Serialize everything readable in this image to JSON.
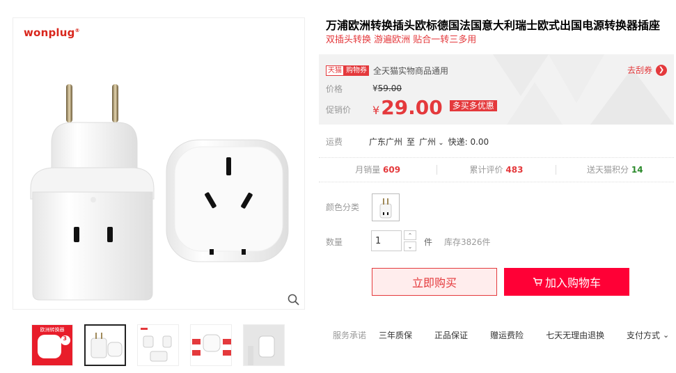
{
  "gallery": {
    "brand": "wonplug",
    "brand_mark": "®",
    "thumbnails": [
      {
        "name": "thumb-1"
      },
      {
        "name": "thumb-2"
      },
      {
        "name": "thumb-3"
      },
      {
        "name": "thumb-4"
      },
      {
        "name": "thumb-5"
      }
    ],
    "thumb1_text": "欧洲转换器",
    "thumb1_num": "3"
  },
  "product": {
    "title": "万浦欧洲转换插头欧标德国法国意大利瑞士欧式出国电源转换器插座",
    "subtitle": "双插头转换 游遍欧洲 贴合一转三多用"
  },
  "pricing": {
    "tag_tmall": "天猫",
    "tag_coupon": "购物券",
    "coupon_desc": "全天猫实物商品通用",
    "get_coupon": "去刮券",
    "price_label": "价格",
    "orig_currency": "¥",
    "orig_price": "59.00",
    "promo_label": "促销价",
    "promo_currency": "¥",
    "promo_price": "29.00",
    "promo_badge": "多买多优惠"
  },
  "shipping": {
    "label": "运费",
    "from": "广东广州",
    "to_word": "至",
    "to": "广州",
    "express": "快递: 0.00"
  },
  "stats": {
    "monthly_sales_label": "月销量",
    "monthly_sales": "609",
    "reviews_label": "累计评价",
    "reviews": "483",
    "points_label": "送天猫积分",
    "points": "14"
  },
  "options": {
    "color_label": "颜色分类",
    "qty_label": "数量",
    "qty_value": "1",
    "unit": "件",
    "stock": "库存3826件"
  },
  "actions": {
    "buy_now": "立即购买",
    "add_cart": "加入购物车"
  },
  "services": {
    "label": "服务承诺",
    "items": [
      "三年质保",
      "正品保证",
      "赠运费险",
      "七天无理由退换"
    ],
    "payment": "支付方式"
  },
  "colors": {
    "accent": "#e4393c",
    "cart": "#ff0036"
  }
}
